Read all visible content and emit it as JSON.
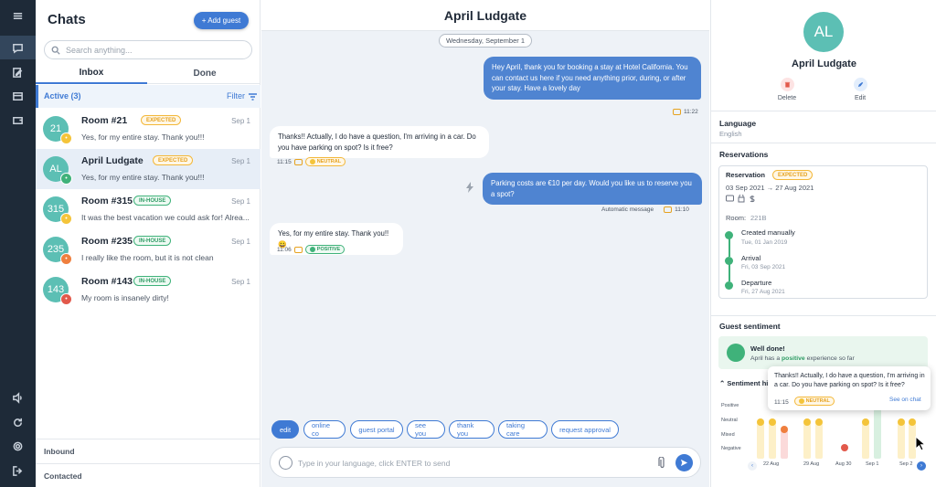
{
  "rail": {
    "icons": [
      "menu-icon",
      "chat-icon",
      "edit-icon",
      "inbox-icon",
      "wallet-icon",
      "volume-icon",
      "refresh-icon",
      "gear-icon",
      "logout-icon"
    ]
  },
  "list": {
    "title": "Chats",
    "add_label": "+ Add guest",
    "search_placeholder": "Search anything...",
    "tabs": [
      "Inbox",
      "Done"
    ],
    "active_label": "Active (3)",
    "filter_label": "Filter",
    "items": [
      {
        "avatar": "21",
        "name": "Room #21",
        "badge": "EXPECTED",
        "date": "Sep 1",
        "preview": "Yes, for my entire stay. Thank you!!!",
        "mood": "yellow"
      },
      {
        "avatar": "AL",
        "name": "April Ludgate",
        "badge": "EXPECTED",
        "date": "Sep 1",
        "preview": "Yes, for my entire stay. Thank you!!!",
        "mood": "green"
      },
      {
        "avatar": "315",
        "name": "Room #315",
        "badge": "IN-HOUSE",
        "date": "Sep 1",
        "preview": "It was the best vacation we could ask for! Alrea...",
        "mood": "yellow"
      },
      {
        "avatar": "235",
        "name": "Room #235",
        "badge": "IN-HOUSE",
        "date": "Sep 1",
        "preview": "I really like the room, but it is not clean",
        "mood": "orange"
      },
      {
        "avatar": "143",
        "name": "Room #143",
        "badge": "IN-HOUSE",
        "date": "Sep 1",
        "preview": "My room is insanely dirty!",
        "mood": "red"
      }
    ],
    "inbound": "Inbound",
    "contacted": "Contacted"
  },
  "conversation": {
    "title": "April Ludgate",
    "date": "Wednesday, September 1",
    "messages": [
      {
        "text": "Hey April, thank you for booking a stay at Hotel California. You can contact us here if you need anything prior, during, or after your stay. Have a lovely day",
        "time": "11:22"
      },
      {
        "text": "Thanks!! Actually, I do have a question, I'm arriving in a car. Do you have parking on spot? Is it free?",
        "time": "11:15",
        "sentiment": "NEUTRAL"
      },
      {
        "text": "Parking costs are €10 per day. Would you like us to reserve you a spot?",
        "time": "11:10",
        "note": "Automatic message"
      },
      {
        "text": "Yes, for my entire stay. Thank you!! 😀",
        "time": "11:06",
        "sentiment": "POSITIVE"
      }
    ],
    "quick_replies": [
      "edit",
      "online co",
      "guest portal",
      "see you",
      "thank you",
      "taking care",
      "request approval"
    ],
    "composer_placeholder": "Type in your language, click ENTER to send"
  },
  "detail": {
    "avatar": "AL",
    "name": "April Ludgate",
    "delete_label": "Delete",
    "edit_label": "Edit",
    "language_title": "Language",
    "language_value": "English",
    "reservations_title": "Reservations",
    "reservation": {
      "label": "Reservation",
      "badge": "EXPECTED",
      "dates": "03 Sep 2021 → 27 Aug 2021",
      "room_label": "Room:",
      "room_value": "221B",
      "events": [
        {
          "title": "Created manually",
          "date": "Tue, 01 Jan 2019"
        },
        {
          "title": "Arrival",
          "date": "Fri, 03 Sep 2021"
        },
        {
          "title": "Departure",
          "date": "Fri, 27 Aug 2021"
        }
      ]
    },
    "sentiment_title": "Guest sentiment",
    "sentiment_card": {
      "title": "Well done!",
      "prefix": "April has a ",
      "highlight": "positive",
      "suffix": " experience so far"
    },
    "history_label": "Sentiment his",
    "tooltip": {
      "text": "Thanks!! Actually, I do have a question, I'm arriving in a car. Do you have parking on spot? Is it free?",
      "time": "11:15",
      "sentiment": "NEUTRAL",
      "link": "See on chat"
    },
    "chart_levels": [
      "Positive",
      "Neutral",
      "Mixed",
      "Negative"
    ],
    "chart_x": [
      "22 Aug",
      "29 Aug",
      "Aug 30",
      "Sep 1",
      "Sep 2"
    ]
  },
  "colors": {
    "accent": "#3f7ad4",
    "positive": "#3fb27a",
    "neutral": "#f4c43a",
    "negative": "#e2594b"
  }
}
